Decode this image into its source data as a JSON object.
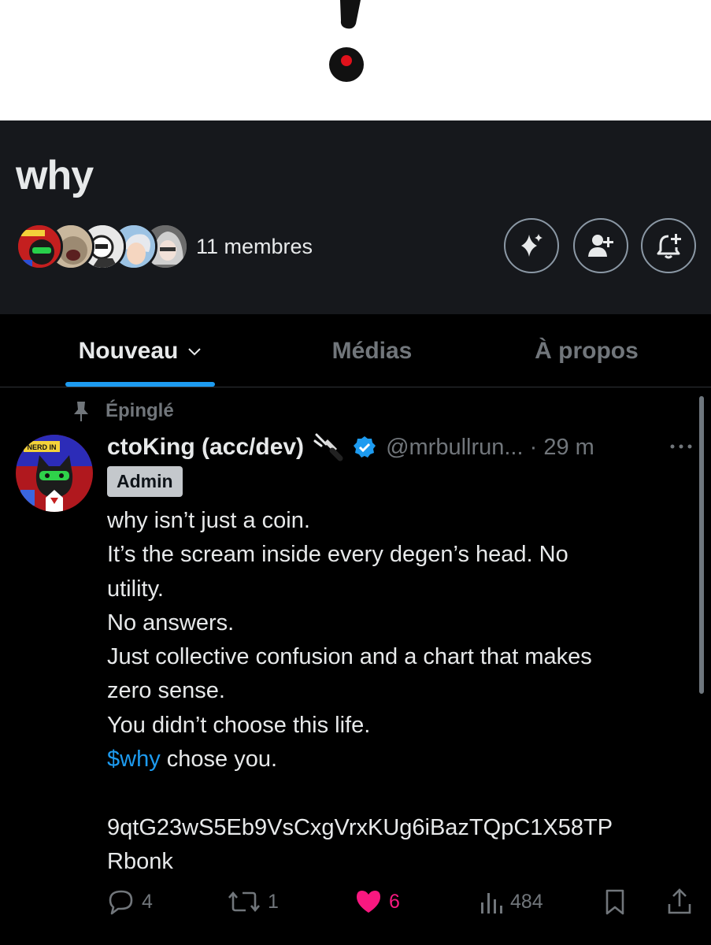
{
  "community": {
    "name": "why",
    "members_label": "11 membres"
  },
  "member_avatars": [
    "member-avatar-nerd",
    "member-avatar-cat",
    "member-avatar-drawing",
    "member-avatar-anime-boy",
    "member-avatar-anime-girl"
  ],
  "header_buttons": [
    "sparkle-icon",
    "add-member-icon",
    "add-notification-icon"
  ],
  "tabs": [
    {
      "label": "Nouveau",
      "active": true,
      "has_chevron": true
    },
    {
      "label": "Médias",
      "active": false
    },
    {
      "label": "À propos",
      "active": false
    }
  ],
  "post": {
    "pinned_label": "Épinglé",
    "author": "ctoKing (acc/dev)",
    "handle_time": "@mrbullrun... · 29 m",
    "role_badge": "Admin",
    "lines": [
      "why isn’t just a coin.",
      "It’s the scream inside every degen’s head. No",
      "utility.",
      "No answers.",
      "Just collective confusion and a chart that makes",
      "zero sense.",
      "You didn’t choose this life."
    ],
    "cashtag": "$why",
    "cashtag_rest": " chose you.",
    "address_lines": [
      "9qtG23wS5Eb9VsCxgVrxKUg6iBazTQpC1X58TP",
      "Rbonk"
    ],
    "stats": {
      "replies": "4",
      "reposts": "1",
      "likes": "6",
      "views": "484"
    }
  },
  "colors": {
    "accent": "#1d9bf0",
    "like": "#f91880",
    "muted": "#71767b",
    "text": "#e7e9ea",
    "header_bg": "#16181c"
  }
}
